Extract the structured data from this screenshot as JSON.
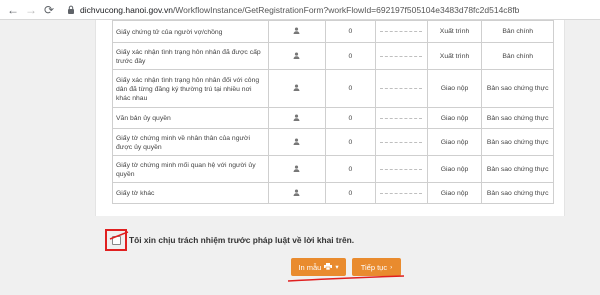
{
  "browser": {
    "url_host": "dichvucong.hanoi.gov.vn",
    "url_path": "/WorkflowInstance/GetRegistrationForm?workFlowId=692197f505104e3483d78fc2d514c8fb"
  },
  "rows": [
    {
      "name": "Giấy chứng tử của người vợ/chồng",
      "qty": "0",
      "kind": "Xuất trình",
      "form": "Bản chính"
    },
    {
      "name": "Giấy xác nhận tình trạng hôn nhân đã được cấp trước đây",
      "qty": "0",
      "kind": "Xuất trình",
      "form": "Bản chính"
    },
    {
      "name": "Giấy xác nhận tình trạng hôn nhân đối với công dân đã từng đăng ký thường trú tại nhiều nơi khác nhau",
      "qty": "0",
      "kind": "Giao nộp",
      "form": "Bản sao chứng thực"
    },
    {
      "name": "Văn bản ủy quyền",
      "qty": "0",
      "kind": "Giao nộp",
      "form": "Bản sao chứng thực"
    },
    {
      "name": "Giấy tờ chứng minh về nhân thân của người được ủy quyền",
      "qty": "0",
      "kind": "Giao nộp",
      "form": "Bản sao chứng thực"
    },
    {
      "name": "Giấy tờ chứng minh mối quan hệ với người ủy quyền",
      "qty": "0",
      "kind": "Giao nộp",
      "form": "Bản sao chứng thực"
    },
    {
      "name": "Giấy tờ khác",
      "qty": "0",
      "kind": "Giao nộp",
      "form": "Bản sao chứng thực"
    }
  ],
  "commitment": "Tôi xin chịu trách nhiệm trước pháp luật về lời khai trên.",
  "buttons": {
    "print_label": "In mẫu",
    "next_label": "Tiếp tục"
  },
  "icons": {
    "row_icon": "user-icon",
    "print_icon": "printer-icon",
    "dropdown_icon": "caret-down-icon",
    "next_icon": "chevron-right-icon"
  },
  "colors": {
    "button": "#e98b2e",
    "annotation": "#e02020"
  }
}
